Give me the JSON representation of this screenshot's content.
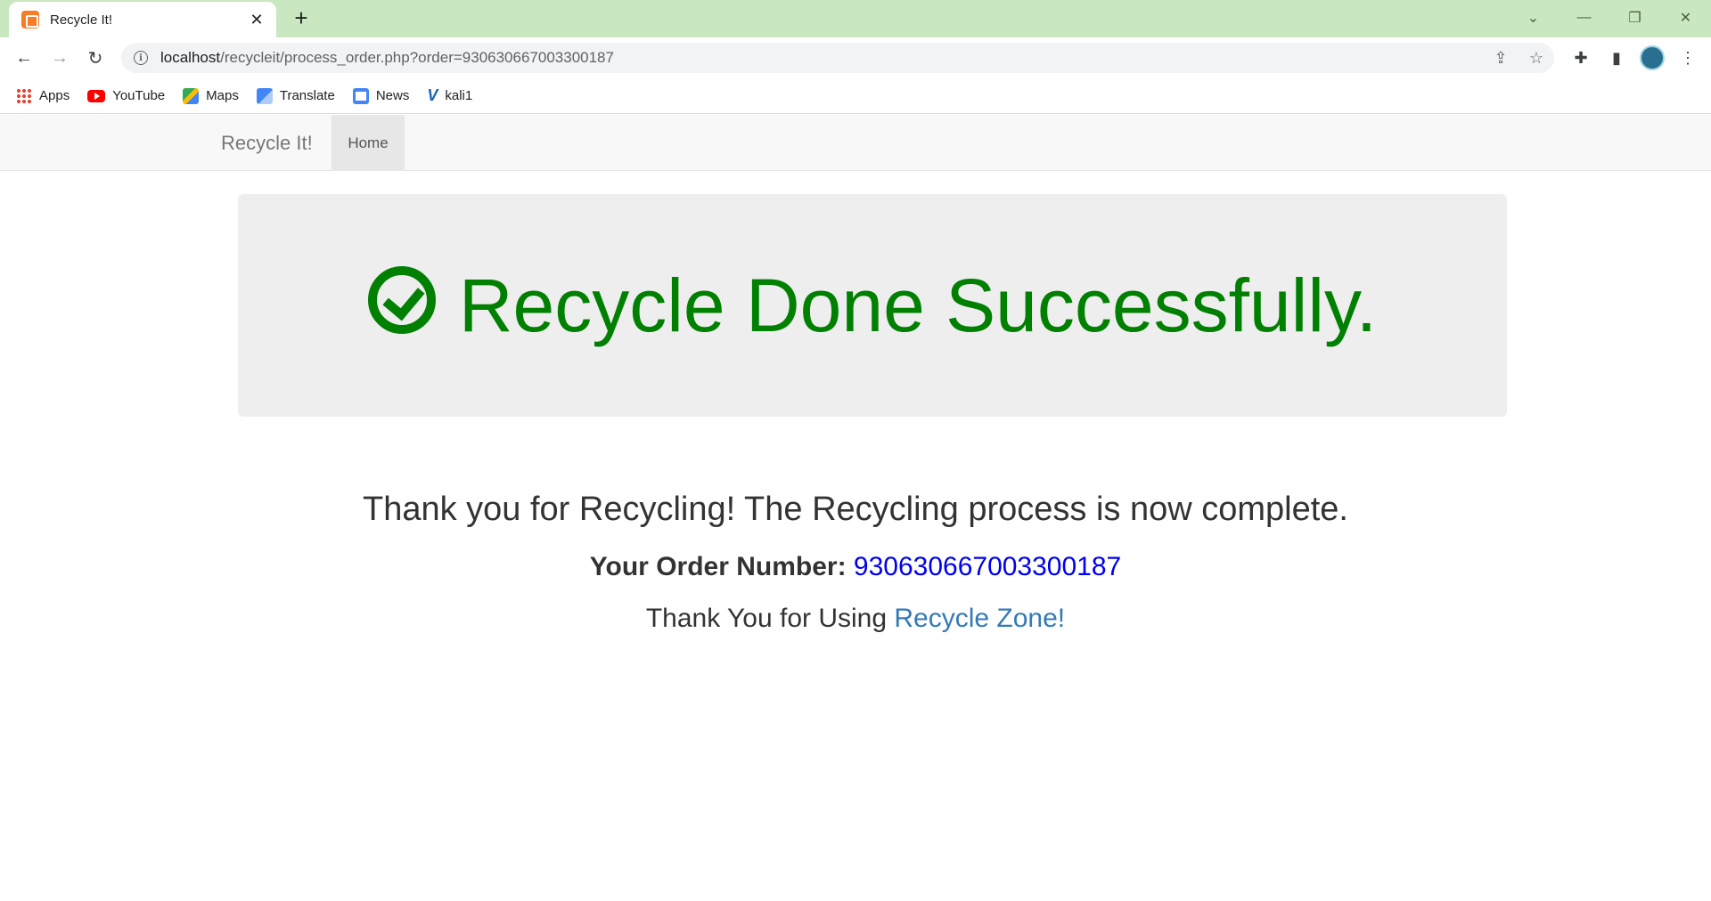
{
  "browser": {
    "tab_title": "Recycle It!",
    "tab_close": "✕",
    "new_tab": "+",
    "url_host": "localhost",
    "url_path": "/recycleit/process_order.php?order=930630667003300187",
    "bookmarks": [
      {
        "label": "Apps",
        "icon": "apps-icon"
      },
      {
        "label": "YouTube",
        "icon": "youtube-icon"
      },
      {
        "label": "Maps",
        "icon": "maps-icon"
      },
      {
        "label": "Translate",
        "icon": "translate-icon"
      },
      {
        "label": "News",
        "icon": "news-icon"
      },
      {
        "label": "kali1",
        "icon": "kali-icon"
      }
    ]
  },
  "navbar": {
    "brand": "Recycle It!",
    "home": "Home"
  },
  "main": {
    "success_heading": "Recycle Done Successfully.",
    "thanks_text": "Thank you for Recycling! The Recycling process is now complete.",
    "order_label": "Your Order Number:",
    "order_number": "930630667003300187",
    "using_prefix": "Thank You for Using",
    "zone_link": "Recycle Zone!"
  },
  "colors": {
    "tabstrip": "#c9e8c1",
    "success_green": "#008000",
    "link_blue": "#337ab7",
    "order_blue": "#0000ee"
  }
}
